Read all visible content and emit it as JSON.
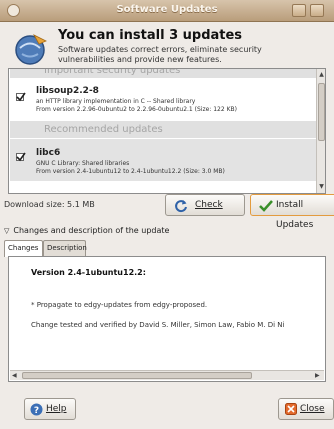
{
  "window": {
    "title": "Software Updates"
  },
  "header": {
    "headline": "You can install 3 updates",
    "subtext": "Software updates correct errors, eliminate security vulnerabilities and provide new features."
  },
  "updates": {
    "groups": [
      {
        "label": "Important security updates"
      },
      {
        "label": "Recommended updates"
      }
    ],
    "items": [
      {
        "name": "libsoup2.2-8",
        "description": "an HTTP library implementation in C -- Shared library",
        "version": "From version 2.2.96-0ubuntu2 to 2.2.96-0ubuntu2.1 (Size: 122 KB)",
        "checked": true
      },
      {
        "name": "libc6",
        "description": "GNU C Library: Shared libraries",
        "version": "From version 2.4-1ubuntu12 to 2.4-1ubuntu12.2 (Size: 3.0 MB)",
        "checked": true
      }
    ]
  },
  "footer": {
    "download_size": "Download size: 5.1 MB",
    "check_label": "Check",
    "install_label": "Install Updates"
  },
  "details": {
    "expander_label": "Changes and description of the update",
    "tabs": [
      "Changes",
      "Description"
    ],
    "version_line": "Version 2.4-1ubuntu12.2:",
    "line1": "* Propagate to edgy-updates from edgy-proposed.",
    "line2": "Change tested and verified by David S. Miller, Simon Law, Fabio M. Di Ni"
  },
  "bottom": {
    "help_label": "Help",
    "close_label": "Close"
  },
  "colors": {
    "titlebar": "#c4a986",
    "install_border": "#e39b3f",
    "list_selected": "#e3e3e3"
  }
}
